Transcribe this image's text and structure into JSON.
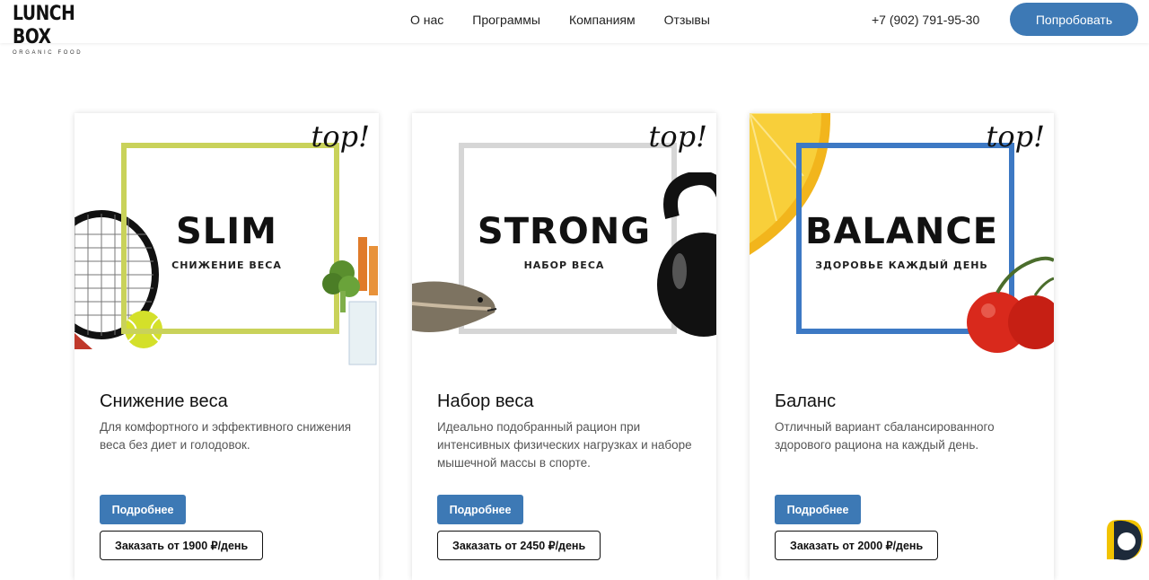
{
  "header": {
    "logo_main": "LUNCH BOX",
    "logo_sub": "ORGANIC FOOD",
    "nav": [
      "О нас",
      "Программы",
      "Компаниям",
      "Отзывы"
    ],
    "phone": "+7 (902) 791-95-30",
    "cta": "Попробовать"
  },
  "cards": [
    {
      "visual_title": "SLIM",
      "visual_sub": "СНИЖЕНИЕ ВЕСА",
      "tag": "top!",
      "title": "Снижение веса",
      "desc": "Для комфортного и эффективного снижения веса без диет и голодовок.",
      "more": "Подробнее",
      "order": "Заказать от 1900 ₽/день",
      "frame_color": "#c9d25a"
    },
    {
      "visual_title": "STRONG",
      "visual_sub": "НАБОР ВЕСА",
      "tag": "top!",
      "title": "Набор веса",
      "desc": "Идеально подобранный рацион при интенсивных физических нагрузках и наборе мышечной массы в спорте.",
      "more": "Подробнее",
      "order": "Заказать от 2450 ₽/день",
      "frame_color": "#d6d6d6"
    },
    {
      "visual_title": "BALANCE",
      "visual_sub": "ЗДОРОВЬЕ КАЖДЫЙ ДЕНЬ",
      "tag": "top!",
      "title": "Баланс",
      "desc": "Отличный вариант сбалансированного здорового рациона на каждый день.",
      "more": "Подробнее",
      "order": "Заказать от 2000 ₽/день",
      "frame_color": "#3d79c4"
    }
  ],
  "colors": {
    "accent": "#3d79b5"
  }
}
